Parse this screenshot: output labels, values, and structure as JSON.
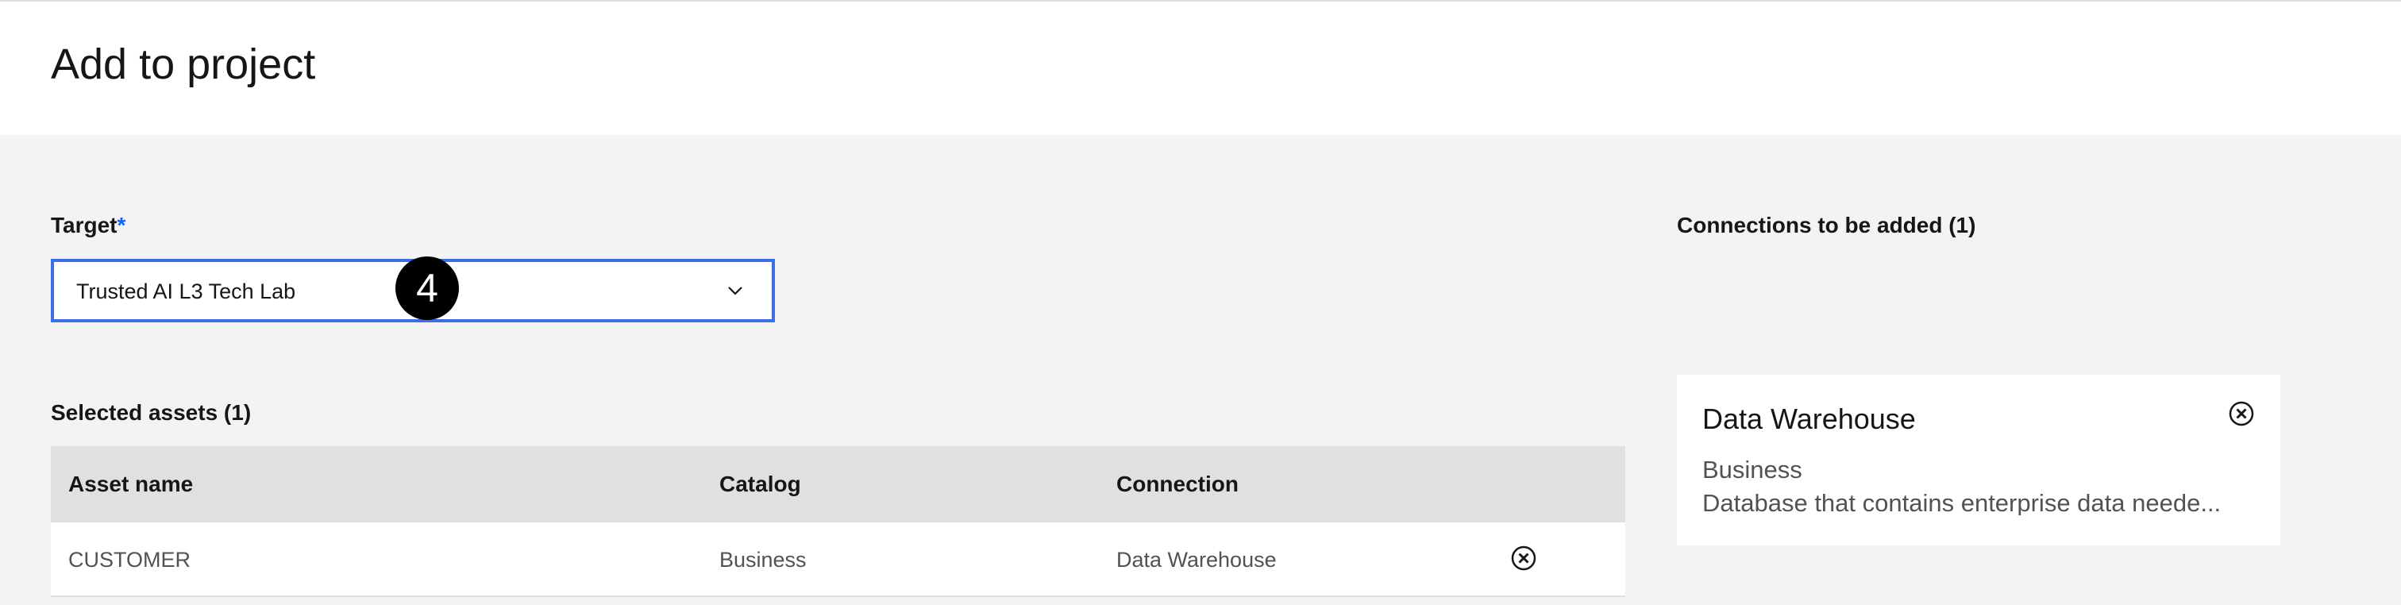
{
  "header": {
    "title": "Add to project"
  },
  "target": {
    "label": "Target",
    "required_mark": "*",
    "selected_value": "Trusted AI L3 Tech Lab",
    "step_badge": "4"
  },
  "selected_assets": {
    "label": "Selected assets (1)",
    "columns": [
      "Asset name",
      "Catalog",
      "Connection"
    ],
    "rows": [
      {
        "asset_name": "CUSTOMER",
        "catalog": "Business",
        "connection": "Data Warehouse"
      }
    ]
  },
  "connections": {
    "label": "Connections to be added (1)",
    "cards": [
      {
        "title": "Data Warehouse",
        "subtitle": "Business",
        "description": "Database that contains enterprise data neede..."
      }
    ]
  },
  "icons": {
    "dropdown": "chevron-down-icon",
    "remove": "close-circle-icon"
  },
  "colors": {
    "accent": "#0f62fe",
    "focus_border": "#3d6ee3",
    "badge": "#000000"
  }
}
